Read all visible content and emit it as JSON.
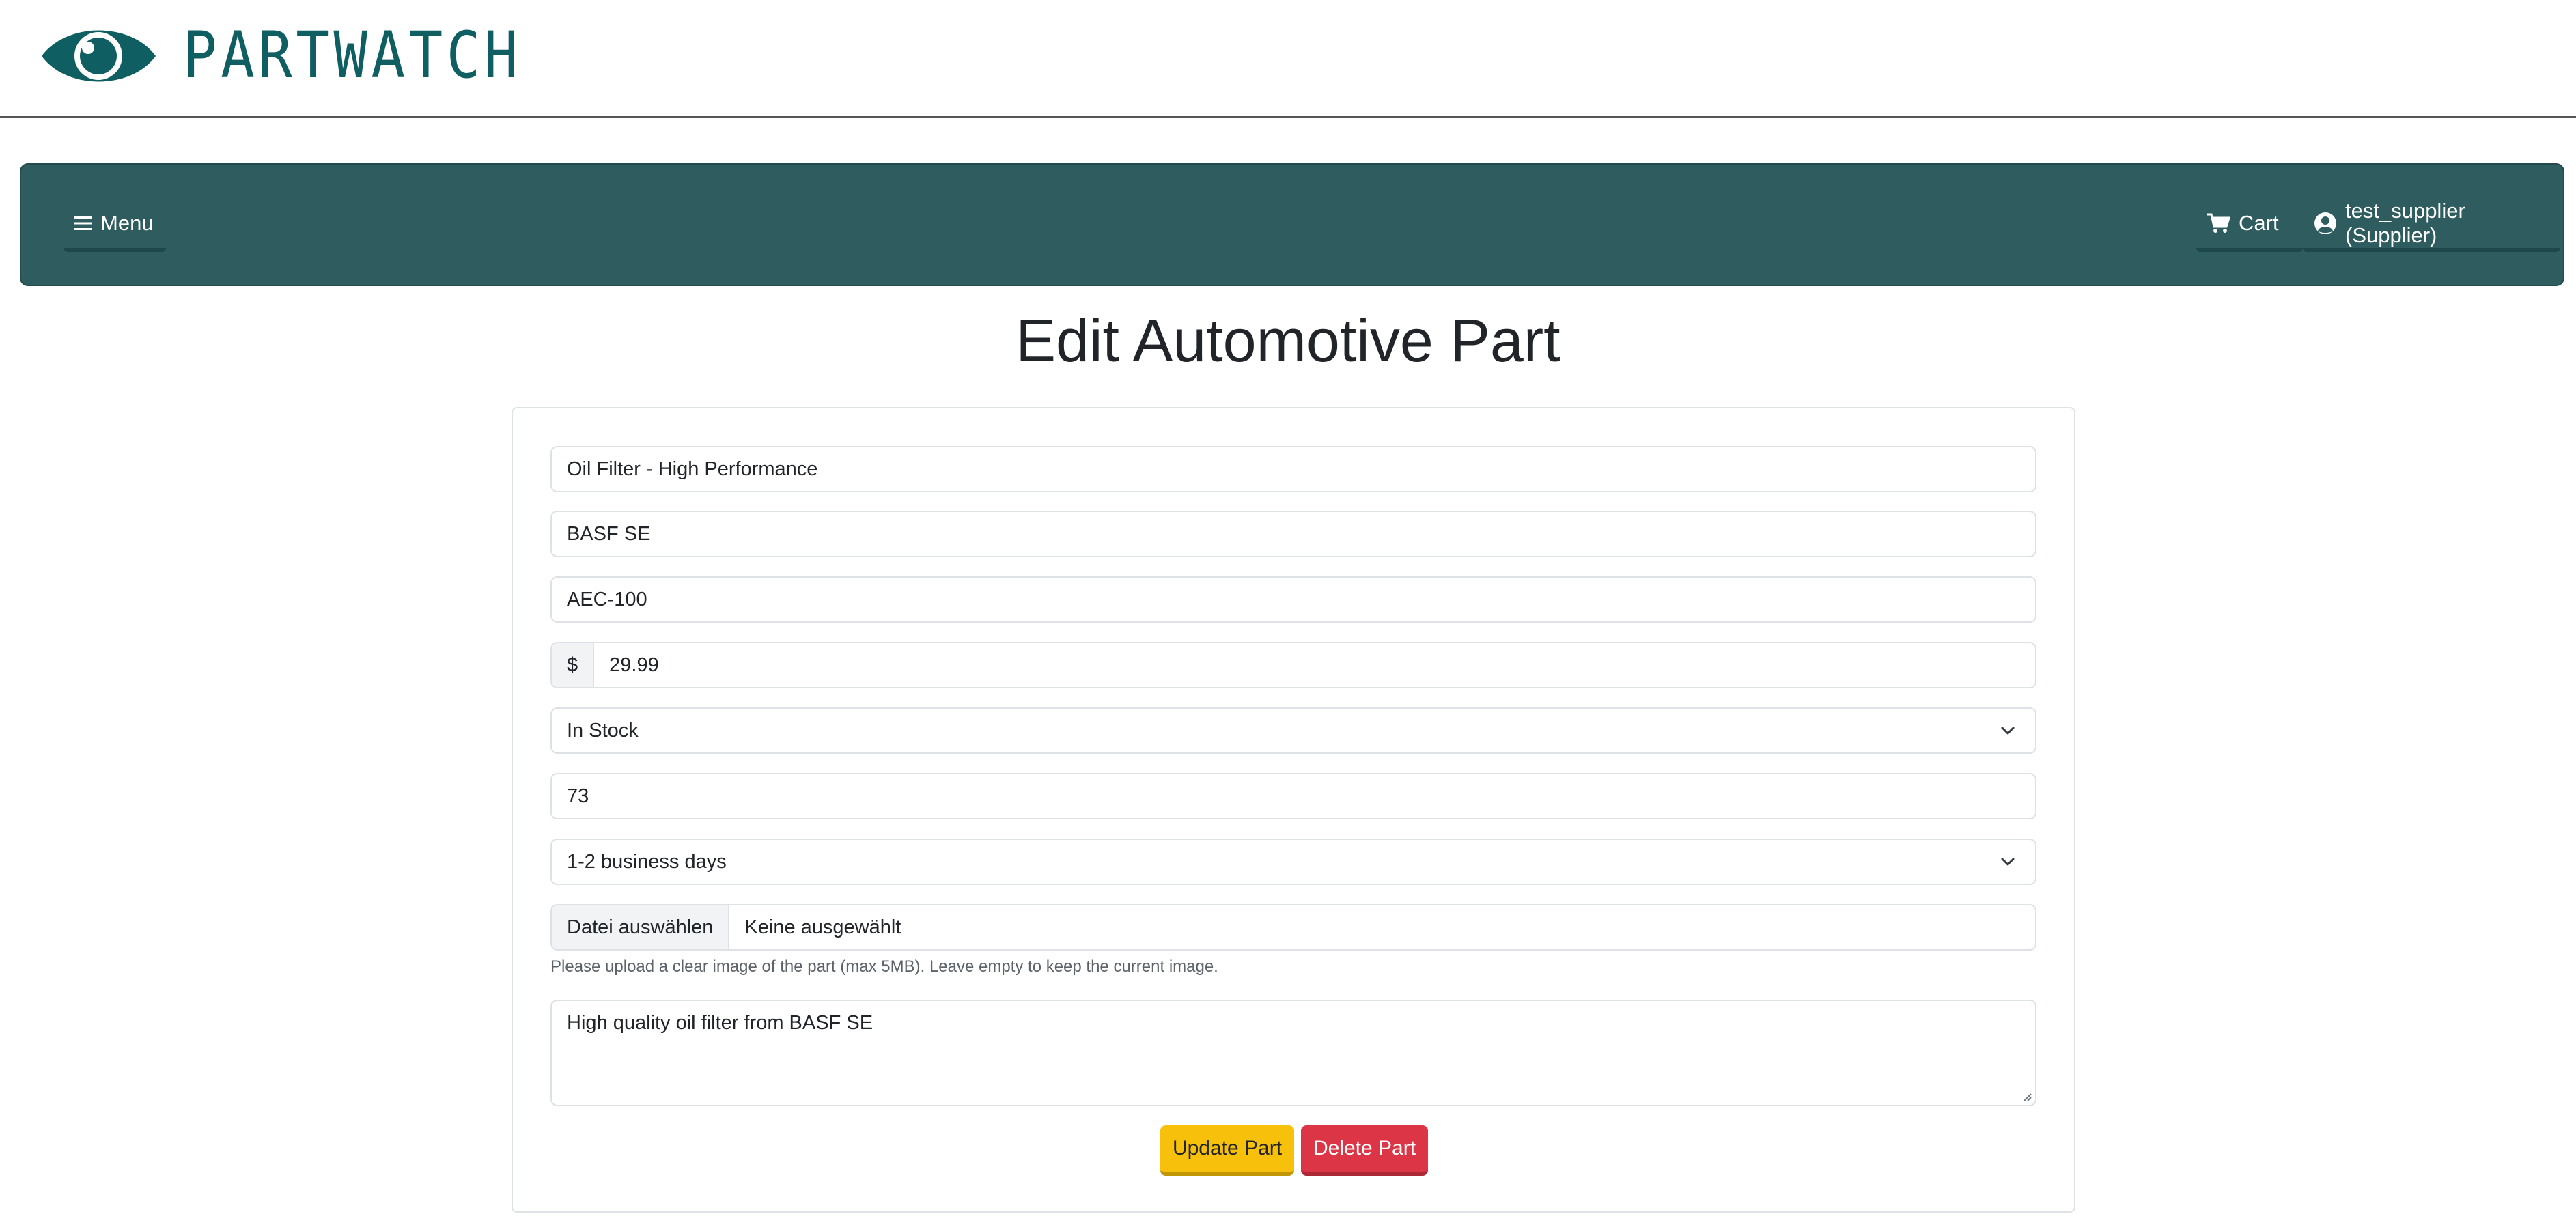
{
  "brand": {
    "name": "PARTWATCH",
    "logo_icon": "eye-logo-icon",
    "color": "#0f5f62"
  },
  "nav": {
    "menu_label": "Menu",
    "menu_icon": "hamburger-icon",
    "cart_label": "Cart",
    "cart_icon": "cart-icon",
    "user_label": "test_supplier (Supplier)",
    "user_icon": "user-circle-icon",
    "background": "#2e5c5f"
  },
  "page": {
    "title": "Edit Automotive Part"
  },
  "form": {
    "name": "Oil Filter - High Performance",
    "manufacturer": "BASF SE",
    "part_number": "AEC-100",
    "price_prefix": "$",
    "price": "29.99",
    "availability": "In Stock",
    "quantity": "73",
    "delivery_time": "1-2 business days",
    "file_button": "Datei auswählen",
    "file_status": "Keine ausgewählt",
    "image_help": "Please upload a clear image of the part (max 5MB). Leave empty to keep the current image.",
    "description": "High quality oil filter from BASF SE",
    "update_button": "Update Part",
    "delete_button": "Delete Part"
  },
  "colors": {
    "update": "#f7c00a",
    "delete": "#dc3545"
  }
}
